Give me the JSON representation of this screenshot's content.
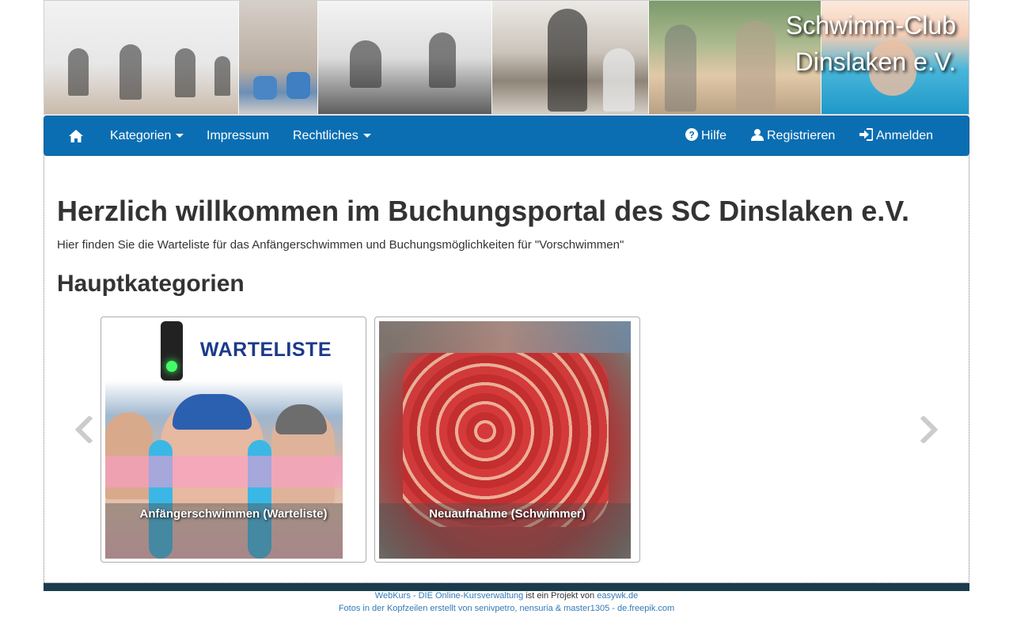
{
  "header": {
    "site_title_line1": "Schwimm-Club",
    "site_title_line2": "Dinslaken e.V."
  },
  "navbar": {
    "home_icon": "home-icon",
    "left_items": [
      {
        "label": "Kategorien",
        "dropdown": true
      },
      {
        "label": "Impressum",
        "dropdown": false
      },
      {
        "label": "Rechtliches",
        "dropdown": true
      }
    ],
    "right_items": [
      {
        "label": "Hilfe",
        "icon": "question-circle-icon"
      },
      {
        "label": "Registrieren",
        "icon": "user-icon"
      },
      {
        "label": "Anmelden",
        "icon": "sign-in-icon"
      }
    ],
    "background_color": "#0b6eb2"
  },
  "main": {
    "heading": "Herzlich willkommen im Buchungsportal des SC Dinslaken e.V.",
    "lead": "Hier finden Sie die Warteliste für das Anfängerschwimmen und Buchungsmöglichkeiten für \"Vorschwimmen\"",
    "categories_heading": "Hauptkategorien",
    "cards": [
      {
        "label": "Anfängerschwimmen (Warteliste)",
        "image_text": "WARTELISTE"
      },
      {
        "label": "Neuaufnahme (Schwimmer)"
      }
    ],
    "carousel_prev_icon": "chevron-left-icon",
    "carousel_next_icon": "chevron-right-icon"
  },
  "footer": {
    "line1_link1": "WebKurs - DIE Online-Kursverwaltung",
    "line1_text": " ist ein Projekt von ",
    "line1_link2": "easywk.de",
    "line2_link": "Fotos in der Kopfzeilen erstellt von senivpetro, nensuria & master1305 - de.freepik.com"
  }
}
